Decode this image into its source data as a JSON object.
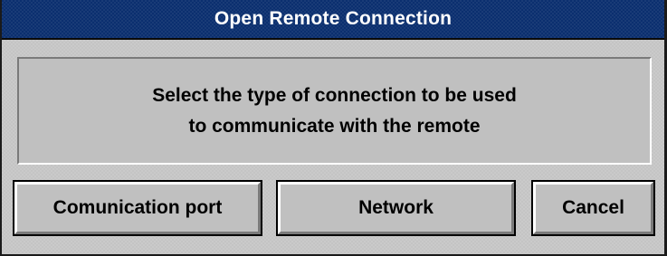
{
  "window": {
    "title": "Open Remote Connection"
  },
  "message": {
    "line1": "Select the type of connection to be used",
    "line2": "to communicate with the remote"
  },
  "buttons": {
    "communication_port": "Comunication port",
    "network": "Network",
    "cancel": "Cancel"
  },
  "colors": {
    "titlebar": "#0b2f6f",
    "title_text": "#ffffff",
    "background": "#c0c0c0"
  }
}
